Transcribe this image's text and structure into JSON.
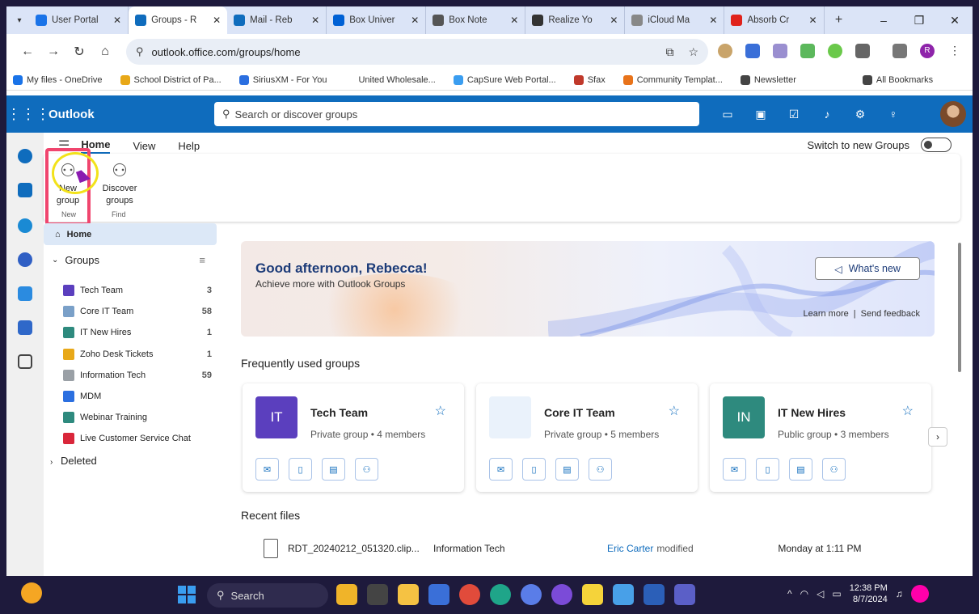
{
  "browser": {
    "tabs": [
      {
        "label": "User Portal",
        "color": "#1a73e8",
        "active": false
      },
      {
        "label": "Groups - R",
        "color": "#0f6cbd",
        "active": true
      },
      {
        "label": "Mail - Reb",
        "color": "#0f6cbd",
        "active": false
      },
      {
        "label": "Box Univer",
        "color": "#0061d5",
        "active": false
      },
      {
        "label": "Box Note",
        "color": "#555555",
        "active": false
      },
      {
        "label": "Realize Yo",
        "color": "#333333",
        "active": false
      },
      {
        "label": "iCloud Ma",
        "color": "#888888",
        "active": false
      },
      {
        "label": "Absorb Cr",
        "color": "#e0221b",
        "active": false
      }
    ],
    "url": "outlook.office.com/groups/home",
    "bookmarks": [
      "My files - OneDrive",
      "School District of Pa...",
      "SiriusXM - For You",
      "United Wholesale...",
      "CapSure Web Portal...",
      "Sfax",
      "Community Templat...",
      "Newsletter",
      "All Bookmarks"
    ],
    "profile_initial": "R"
  },
  "outlook": {
    "app_name": "Outlook",
    "search_placeholder": "Search or discover groups",
    "ribbon_tabs": [
      "Home",
      "View",
      "Help"
    ],
    "switch_label": "Switch to new Groups",
    "ribbon": {
      "new_group": "New group",
      "new_group_chevron": "⌄",
      "discover": "Discover groups",
      "group_new": "New",
      "group_find": "Find"
    },
    "nav": {
      "home": "Home",
      "groups_header": "Groups",
      "deleted": "Deleted",
      "groups": [
        {
          "name": "Tech Team",
          "count": "3",
          "color": "#5b3fbe"
        },
        {
          "name": "Core IT Team",
          "count": "58",
          "color": "#7aa0c8"
        },
        {
          "name": "IT New Hires",
          "count": "1",
          "color": "#2e8a7e"
        },
        {
          "name": "Zoho Desk Tickets",
          "count": "1",
          "color": "#e8a818"
        },
        {
          "name": "Information Tech",
          "count": "59",
          "color": "#9aa0a6"
        },
        {
          "name": "MDM",
          "count": "",
          "color": "#2b6fe0"
        },
        {
          "name": "Webinar Training",
          "count": "",
          "color": "#2e8a7e"
        },
        {
          "name": "Live Customer Service Chat",
          "count": "",
          "color": "#d9263a"
        }
      ]
    },
    "banner": {
      "greeting": "Good afternoon, Rebecca!",
      "subtitle": "Achieve more with Outlook Groups",
      "whats_new": "What's new",
      "learn_more": "Learn more",
      "separator": "|",
      "send_feedback": "Send feedback"
    },
    "frequent_header": "Frequently used groups",
    "cards": [
      {
        "initials": "IT",
        "name": "Tech Team",
        "meta": "Private group • 4 members",
        "color": "#5b3fbe"
      },
      {
        "initials": "",
        "name": "Core IT Team",
        "meta": "Private group • 5 members",
        "color": "#eaf2fb"
      },
      {
        "initials": "IN",
        "name": "IT New Hires",
        "meta": "Public group • 3 members",
        "color": "#2e8a7e"
      }
    ],
    "recent_header": "Recent files",
    "recent_file": {
      "name": "RDT_20240212_051320.clip...",
      "location": "Information Tech",
      "author": "Eric Carter",
      "action": "modified",
      "time": "Monday at 1:11 PM"
    }
  },
  "taskbar": {
    "search": "Search",
    "time": "12:38 PM",
    "date": "8/7/2024"
  }
}
